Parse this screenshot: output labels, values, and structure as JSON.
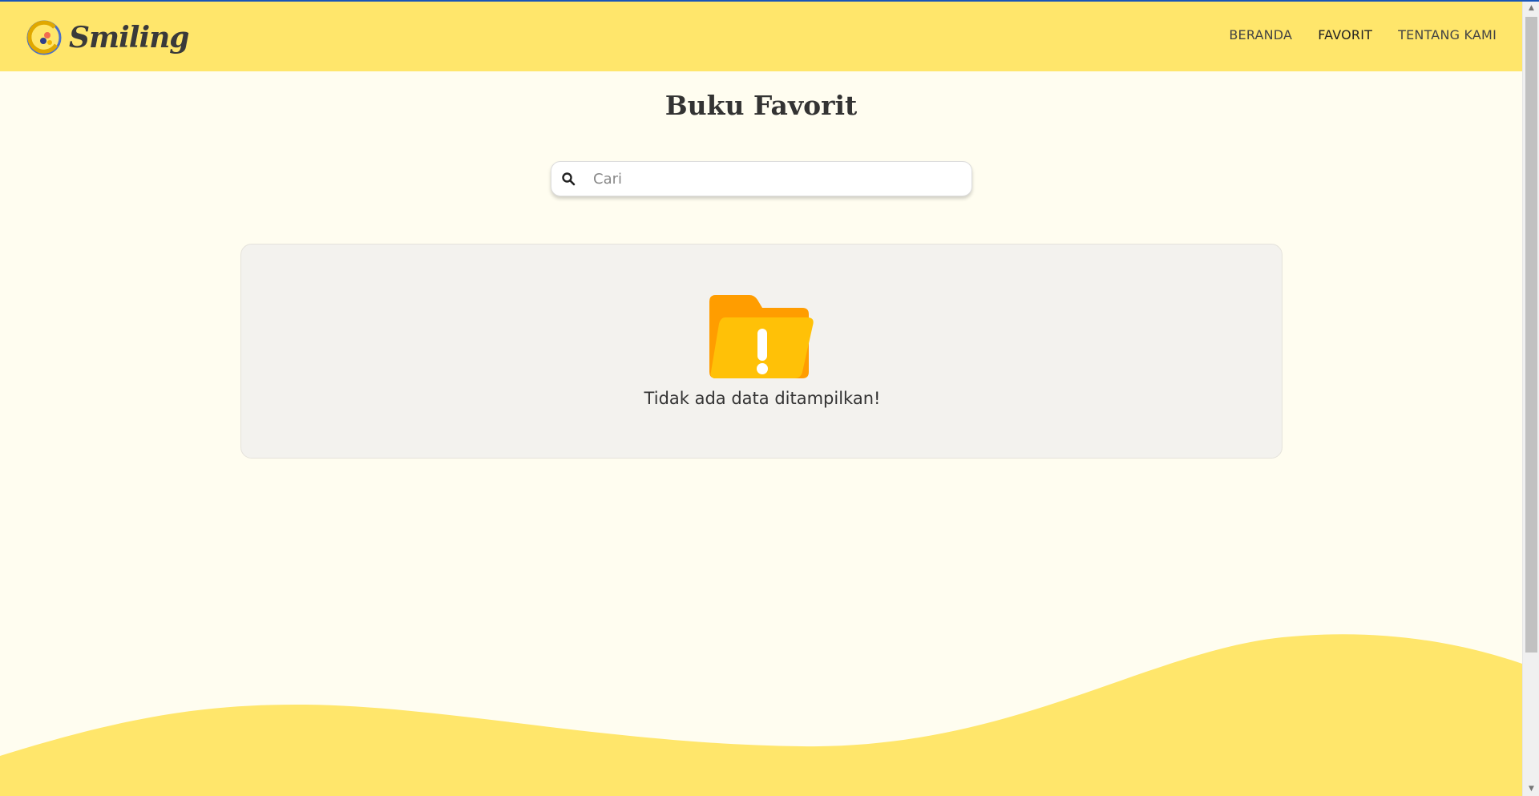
{
  "brand": {
    "name": "Smiling"
  },
  "nav": {
    "items": [
      {
        "label": "BERANDA"
      },
      {
        "label": "FAVORIT"
      },
      {
        "label": "TENTANG KAMI"
      }
    ]
  },
  "main": {
    "title": "Buku Favorit",
    "search": {
      "placeholder": "Cari",
      "value": ""
    },
    "empty_state": {
      "message": "Tidak ada data ditampilkan!"
    }
  },
  "colors": {
    "navbar": "#ffe66b",
    "background": "#fffdf0",
    "folder_back": "#ff9d00",
    "folder_front": "#ffc107"
  },
  "icons": [
    "logo-icon",
    "search-icon",
    "folder-warning-icon"
  ]
}
